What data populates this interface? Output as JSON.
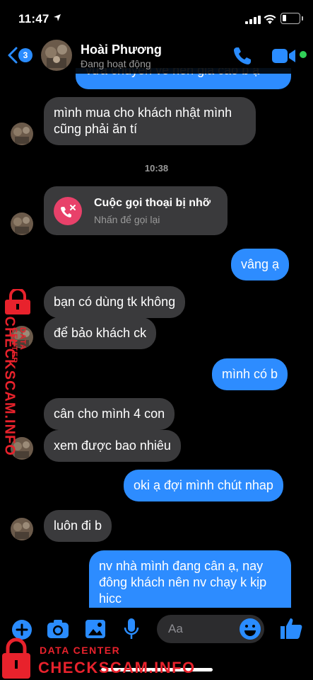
{
  "status_bar": {
    "time": "11:47"
  },
  "header": {
    "back_badge": "3",
    "contact_name": "Hoài Phương",
    "contact_status": "Đang hoạt động"
  },
  "messages": [
    {
      "side": "out",
      "text": "vừa chuyển về nên giá cao b ạ",
      "partial": true
    },
    {
      "side": "in",
      "text_lines": [
        "mình mua cho khách nhật mình",
        "cũng phải ăn tí"
      ]
    },
    {
      "type": "time",
      "text": "10:38"
    },
    {
      "type": "missed_call",
      "title": "Cuộc gọi thoại bị nhỡ",
      "subtitle": "Nhấn để gọi lại"
    },
    {
      "side": "out",
      "text": "vâng ạ"
    },
    {
      "side": "in",
      "text": "bạn có dùng tk không"
    },
    {
      "side": "in",
      "text": "để bảo khách ck"
    },
    {
      "side": "out",
      "text": "mình có b"
    },
    {
      "side": "in",
      "text": "cân cho mình 4 con"
    },
    {
      "side": "in",
      "text": "xem được bao nhiêu"
    },
    {
      "side": "out",
      "text": "oki ạ đợi mình chút nhap"
    },
    {
      "side": "in",
      "text": "luôn đi b"
    },
    {
      "side": "out",
      "text_lines": [
        "nv nhà mình đang cân ạ, nay",
        "đông khách nên nv chạy k kịp",
        "hicc"
      ]
    }
  ],
  "composer": {
    "placeholder": "Aa"
  },
  "watermark": {
    "vertical_small": "DATA CENTER",
    "vertical_large": "CHECKSCAM.INFO",
    "bottom_small": "DATA CENTER",
    "bottom_large": "CHECKSCAM.INFO"
  },
  "colors": {
    "outgoing_bubble": "#2d8cff",
    "incoming_bubble": "#3a3a3c",
    "accent": "#2a8cff",
    "missed_call": "#e8416a",
    "online": "#31d158",
    "watermark": "#e8222c"
  }
}
